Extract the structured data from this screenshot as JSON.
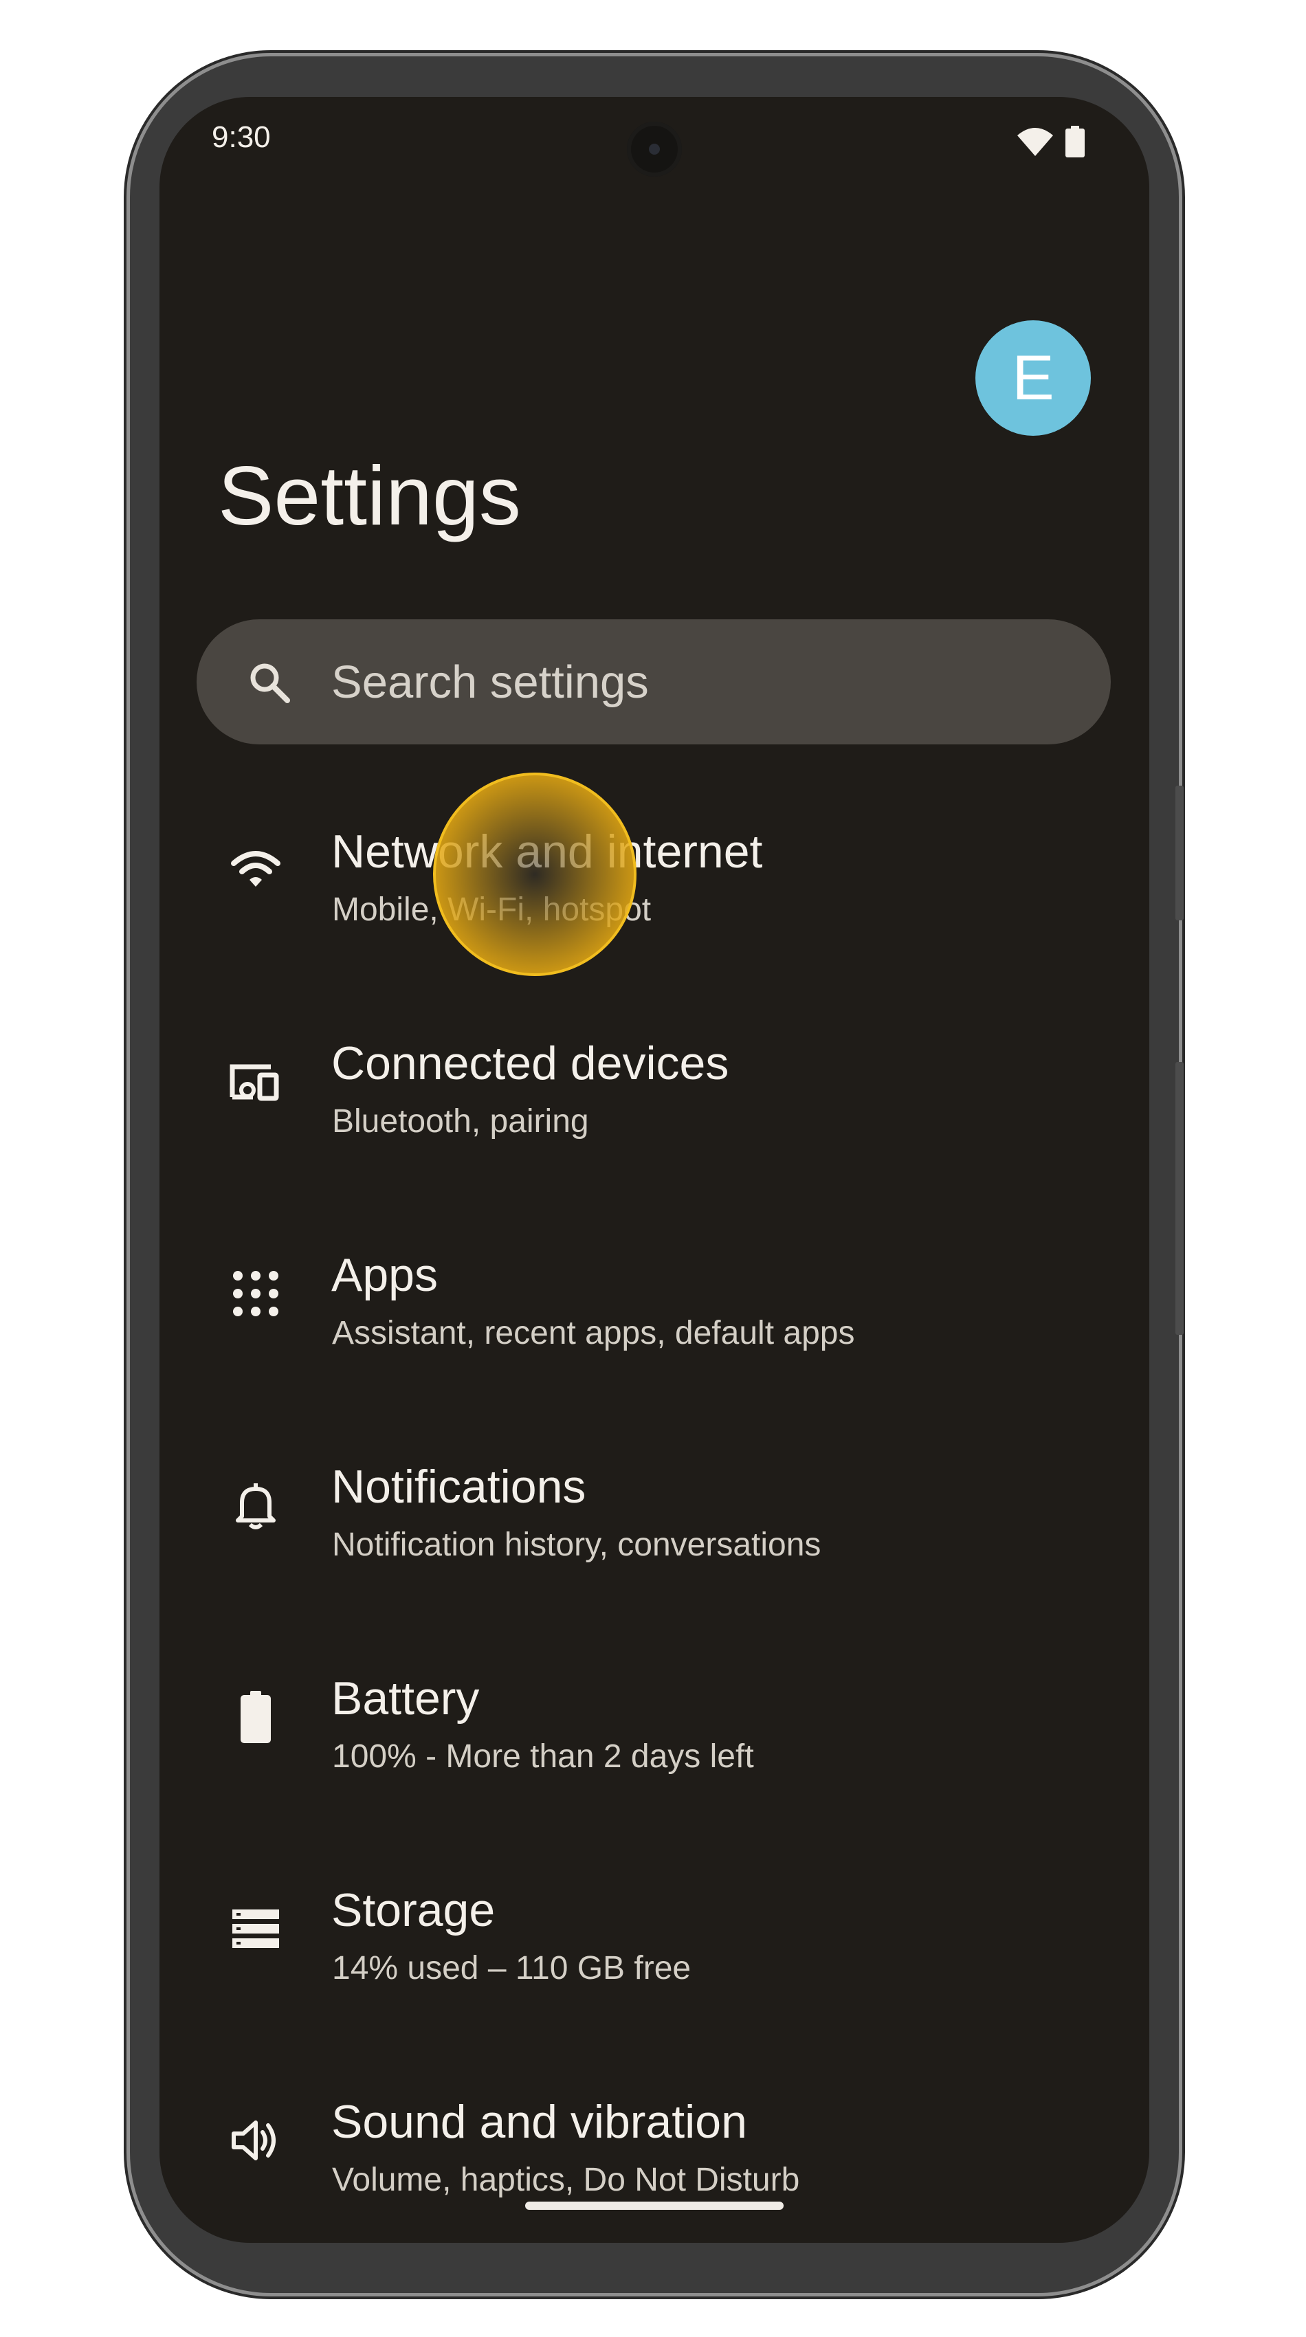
{
  "status_bar": {
    "time": "9:30",
    "icons": [
      "wifi-icon",
      "battery-icon"
    ]
  },
  "header": {
    "avatar_letter": "E",
    "avatar_color": "#6ec3dd",
    "title": "Settings"
  },
  "search": {
    "placeholder": "Search settings",
    "icon": "search-icon"
  },
  "settings": [
    {
      "name": "network",
      "icon": "wifi-icon",
      "title": "Network and internet",
      "subtitle": "Mobile, Wi-Fi, hotspot"
    },
    {
      "name": "connected-devices",
      "icon": "devices-icon",
      "title": "Connected devices",
      "subtitle": "Bluetooth, pairing"
    },
    {
      "name": "apps",
      "icon": "apps-grid-icon",
      "title": "Apps",
      "subtitle": "Assistant, recent apps, default apps"
    },
    {
      "name": "notifications",
      "icon": "bell-icon",
      "title": "Notifications",
      "subtitle": "Notification history, conversations"
    },
    {
      "name": "battery",
      "icon": "battery-icon",
      "title": "Battery",
      "subtitle": "100% - More than 2 days left"
    },
    {
      "name": "storage",
      "icon": "storage-icon",
      "title": "Storage",
      "subtitle": "14% used – 110 GB free"
    },
    {
      "name": "sound",
      "icon": "volume-icon",
      "title": "Sound and vibration",
      "subtitle": "Volume, haptics, Do Not Disturb"
    }
  ],
  "theme": {
    "background": "#1f1c18",
    "text_primary": "#f4f0ea",
    "text_secondary": "#d4cfc6",
    "search_bg": "#4a4641",
    "touch_indicator": "#f4be1e"
  }
}
